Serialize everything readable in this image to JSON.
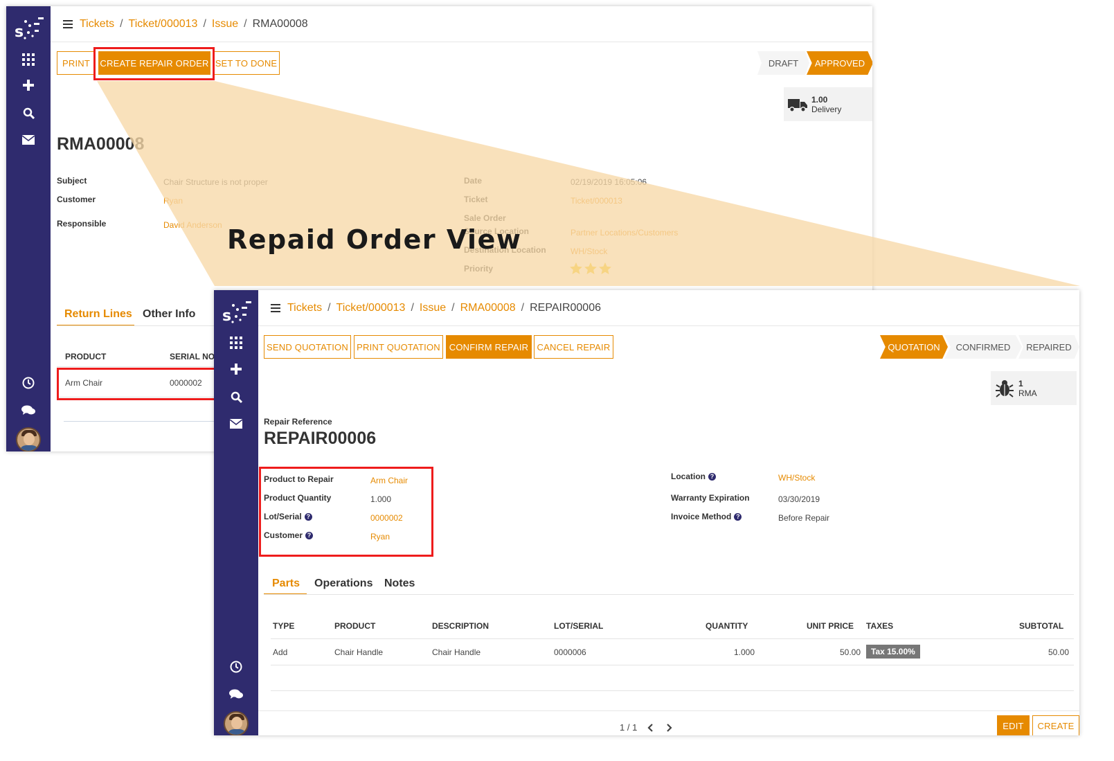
{
  "overlay_caption": "Repaid Order View",
  "back": {
    "breadcrumb": [
      "Tickets",
      "Ticket/000013",
      "Issue"
    ],
    "breadcrumb_current": "RMA00008",
    "buttons": {
      "print": "PRINT",
      "create_repair": "CREATE REPAIR ORDER",
      "set_done": "SET TO DONE"
    },
    "stages": {
      "draft": "DRAFT",
      "approved": "APPROVED"
    },
    "smart_button": {
      "value": "1.00",
      "label": "Delivery"
    },
    "title": "RMA00008",
    "left_fields": [
      {
        "label": "Subject",
        "value": "Chair Structure is not proper"
      },
      {
        "label": "Customer",
        "value": "Ryan"
      },
      {
        "label": "Responsible",
        "value": "David Anderson"
      }
    ],
    "right_fields": [
      {
        "label": "Date",
        "value": "02/19/2019 16:05:06"
      },
      {
        "label": "Ticket",
        "value": "Ticket/000013"
      },
      {
        "label": "Sale Order",
        "value": ""
      },
      {
        "label": "Source Location",
        "value": "Partner Locations/Customers"
      },
      {
        "label": "Destination Location",
        "value": "WH/Stock"
      },
      {
        "label": "Priority",
        "value": ""
      }
    ],
    "priority_stars": 3,
    "tabs": [
      "Return Lines",
      "Other Info"
    ],
    "table_headers": [
      "PRODUCT",
      "SERIAL NO"
    ],
    "rows": [
      {
        "product": "Arm Chair",
        "serial": "0000002"
      }
    ]
  },
  "front": {
    "breadcrumb": [
      "Tickets",
      "Ticket/000013",
      "Issue",
      "RMA00008"
    ],
    "breadcrumb_current": "REPAIR00006",
    "buttons": {
      "send_quotation": "SEND QUOTATION",
      "print_quotation": "PRINT QUOTATION",
      "confirm_repair": "CONFIRM REPAIR",
      "cancel_repair": "CANCEL REPAIR"
    },
    "stages": {
      "quotation": "QUOTATION",
      "confirmed": "CONFIRMED",
      "repaired": "REPAIRED"
    },
    "smart_button": {
      "value": "1",
      "label": "RMA"
    },
    "ref_label": "Repair Reference",
    "title": "REPAIR00006",
    "left_fields": [
      {
        "label": "Product to Repair",
        "value": "Arm Chair"
      },
      {
        "label": "Product Quantity",
        "value": "1.000"
      },
      {
        "label": "Lot/Serial",
        "value": "0000002"
      },
      {
        "label": "Customer",
        "value": "Ryan"
      }
    ],
    "right_fields": [
      {
        "label": "Location",
        "value": "WH/Stock"
      },
      {
        "label": "Warranty Expiration",
        "value": "03/30/2019"
      },
      {
        "label": "Invoice Method",
        "value": "Before Repair"
      }
    ],
    "tabs": [
      "Parts",
      "Operations",
      "Notes"
    ],
    "table_headers": [
      "TYPE",
      "PRODUCT",
      "DESCRIPTION",
      "LOT/SERIAL",
      "QUANTITY",
      "UNIT PRICE",
      "TAXES",
      "SUBTOTAL"
    ],
    "rows": [
      {
        "type": "Add",
        "product": "Chair Handle",
        "description": "Chair Handle",
        "lot": "0000006",
        "quantity": "1.000",
        "unit_price": "50.00",
        "taxes": "Tax 15.00%",
        "subtotal": "50.00"
      }
    ],
    "pager": "1 / 1",
    "footer_buttons": {
      "edit": "EDIT",
      "create": "CREATE"
    }
  },
  "colors": {
    "accent": "#e68a00",
    "sidebar": "#2f2b6e",
    "highlight": "#ee1c1c",
    "callout": "#f7d9a8"
  },
  "icons": [
    "menu-icon",
    "apps-grid-icon",
    "plus-icon",
    "search-icon",
    "envelope-icon",
    "clock-icon",
    "chat-icon",
    "truck-icon",
    "bug-icon",
    "star-icon",
    "chevron-left-icon",
    "chevron-right-icon",
    "help-icon"
  ]
}
